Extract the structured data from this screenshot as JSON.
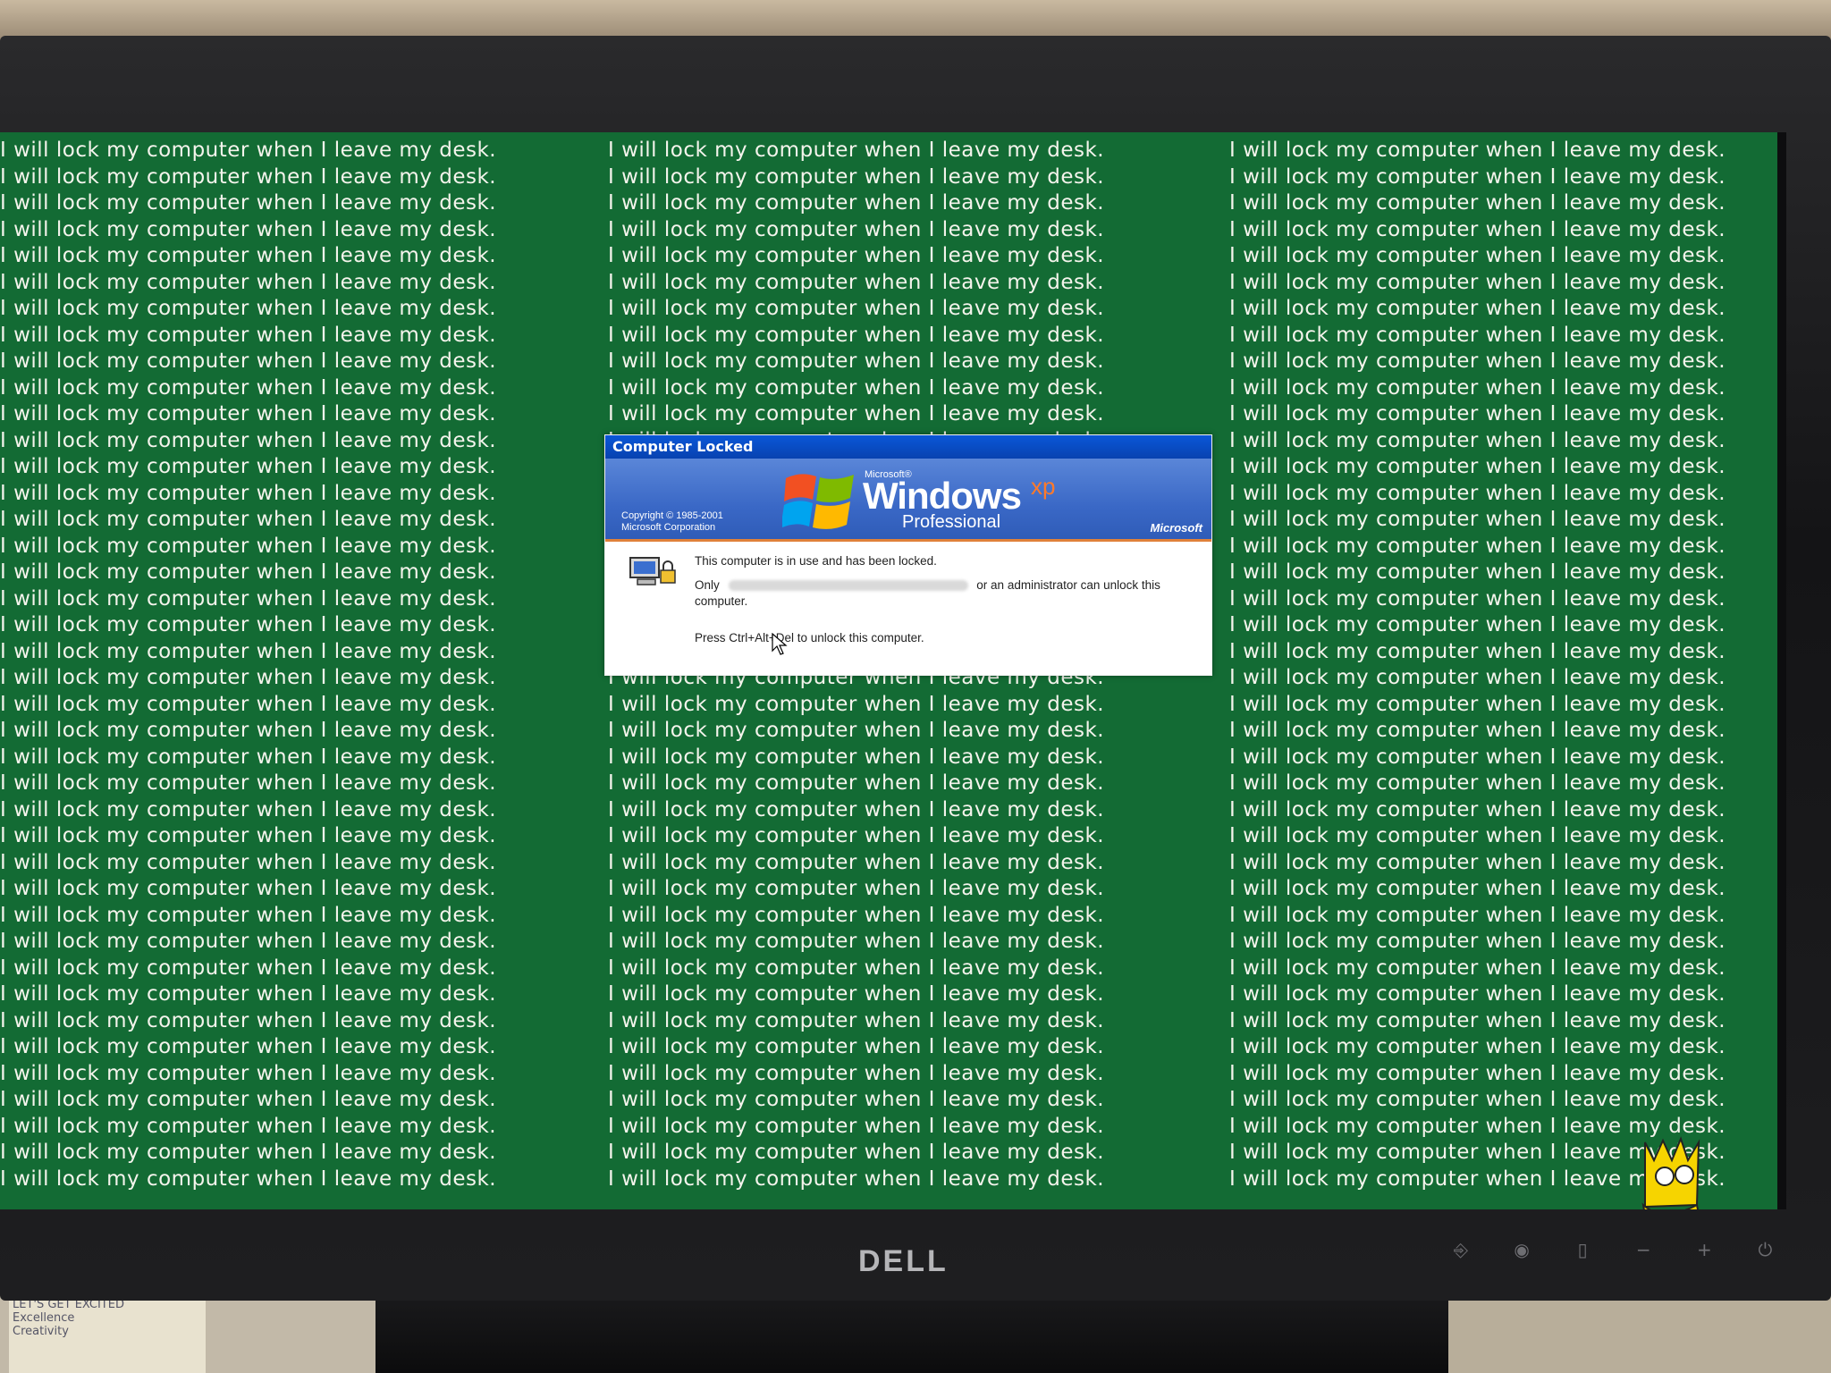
{
  "background": {
    "repeated_line": "I will lock my computer when I leave my desk.",
    "color": "#136b34"
  },
  "dialog": {
    "title": "Computer Locked",
    "banner": {
      "microsoft_small": "Microsoft®",
      "product": "Windows",
      "product_suffix": "xp",
      "edition": "Professional",
      "copyright": "Copyright © 1985-2001",
      "copyright_owner": "Microsoft Corporation",
      "brand": "Microsoft"
    },
    "message_locked": "This computer is in use and has been locked.",
    "message_only_prefix": "Only",
    "message_only_suffix": "or an administrator can unlock this computer.",
    "message_press": "Press Ctrl+Alt+Del to unlock this computer."
  },
  "monitor": {
    "brand": "DELL"
  },
  "desk_note": {
    "line1": "LET'S GET EXCITED",
    "line2": "Excellence",
    "line3": "Creativity"
  }
}
